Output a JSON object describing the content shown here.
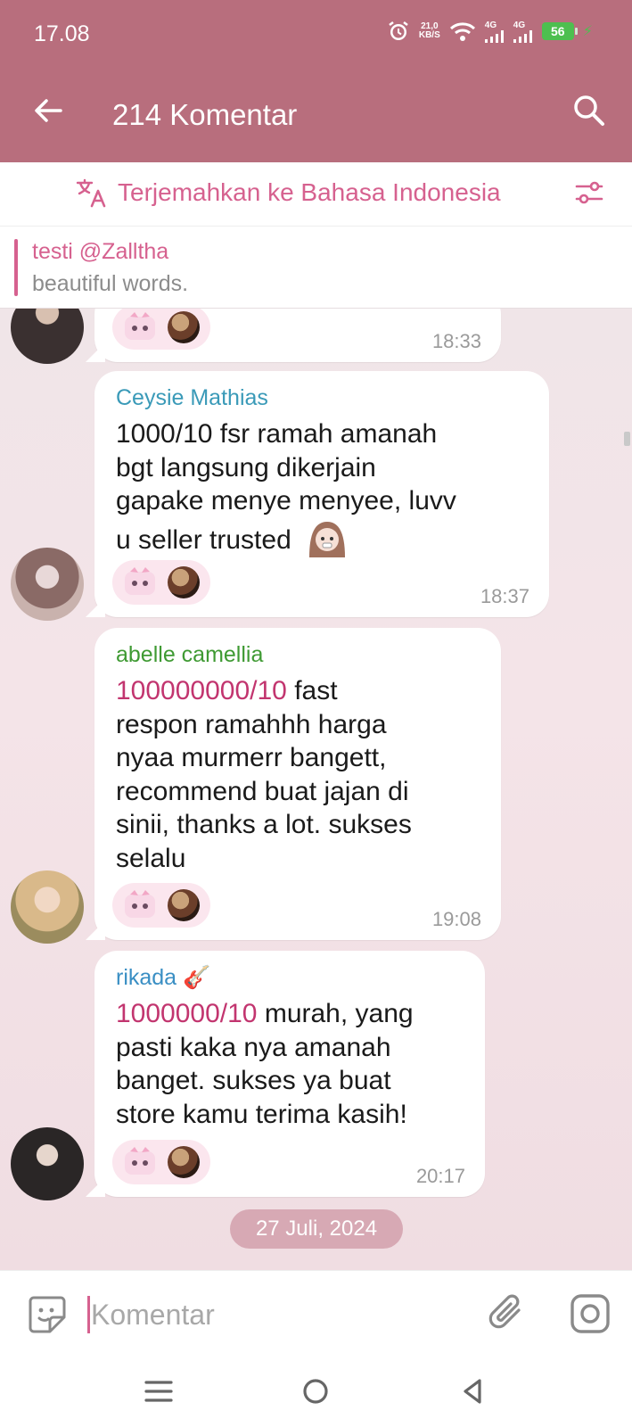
{
  "status_bar": {
    "time": "17.08",
    "net_speed_value": "21,0",
    "net_speed_unit": "KB/S",
    "signal_1": "4G",
    "signal_2": "4G",
    "battery": "56"
  },
  "header": {
    "title": "214 Komentar"
  },
  "translate_bar": {
    "label": "Terjemahkan ke Bahasa Indonesia"
  },
  "pinned": {
    "title": "testi @Zalltha",
    "text": "beautiful words."
  },
  "messages": [
    {
      "sender": "",
      "text": "",
      "time": "18:33"
    },
    {
      "sender": "Ceysie Mathias",
      "sender_color": "#3a9ab8",
      "lines": [
        "1000/10 fsr ramah amanah",
        "bgt langsung dikerjain",
        "gapake menye menyee, luvv",
        "u seller trusted"
      ],
      "time": "18:37"
    },
    {
      "sender": "abelle camellia",
      "sender_color": "#3f9a33",
      "highlight": "100000000/10",
      "lines": [
        " fast",
        "respon ramahhh harga",
        "nyaa murmerr bangett,",
        "recommend buat jajan di",
        "sinii, thanks a lot. sukses",
        "selalu"
      ],
      "time": "19:08"
    },
    {
      "sender": "rikada",
      "sender_color": "#3a8fc4",
      "sender_emoji": "🎸",
      "highlight": "1000000/10",
      "lines": [
        " murah, yang",
        "pasti kaka nya amanah",
        "banget. sukses ya buat",
        "store kamu terima kasih!"
      ],
      "time": "20:17"
    }
  ],
  "date_separator": "27 Juli, 2024",
  "composer": {
    "placeholder": "Komentar"
  },
  "colors": {
    "header_bg": "#b86e7d",
    "accent_pink": "#d6618f",
    "highlight_text": "#c2356f"
  }
}
